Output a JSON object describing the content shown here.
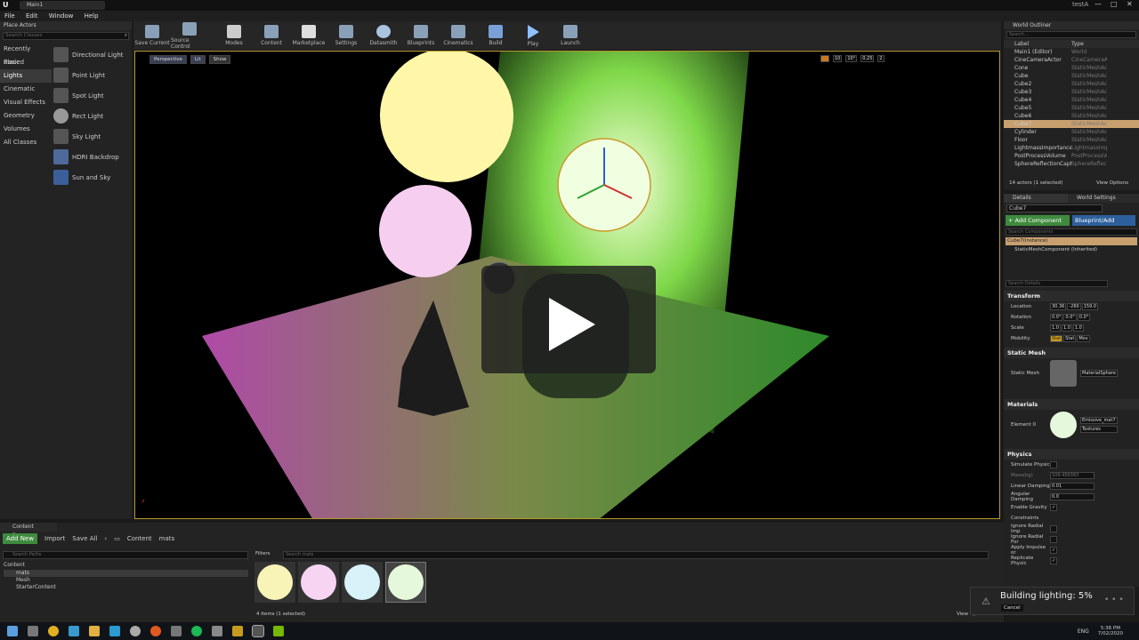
{
  "app": {
    "tab_title": "Main1",
    "project": "testA"
  },
  "menu": [
    "File",
    "Edit",
    "Window",
    "Help"
  ],
  "toolbar": [
    {
      "label": "Save Current",
      "icon": "save-icon"
    },
    {
      "label": "Source Control",
      "icon": "source-control-icon"
    },
    {
      "label": "Modes",
      "icon": "modes-icon"
    },
    {
      "label": "Content",
      "icon": "content-icon"
    },
    {
      "label": "Marketplace",
      "icon": "marketplace-icon"
    },
    {
      "label": "Settings",
      "icon": "settings-icon"
    },
    {
      "label": "Datasmith",
      "icon": "datasmith-icon"
    },
    {
      "label": "Blueprints",
      "icon": "blueprints-icon"
    },
    {
      "label": "Cinematics",
      "icon": "cinematics-icon"
    },
    {
      "label": "Build",
      "icon": "build-icon"
    },
    {
      "label": "Play",
      "icon": "play-icon"
    },
    {
      "label": "Launch",
      "icon": "launch-icon"
    }
  ],
  "place_actors": {
    "title": "Place Actors",
    "search_placeholder": "Search Classes",
    "categories": [
      "Recently Placed",
      "Basic",
      "Lights",
      "Cinematic",
      "Visual Effects",
      "Geometry",
      "Volumes",
      "All Classes"
    ],
    "actors": [
      "Directional Light",
      "Point Light",
      "Spot Light",
      "Rect Light",
      "Sky Light",
      "HDRI Backdrop",
      "Sun and Sky"
    ]
  },
  "viewport": {
    "perspective": "Perspective",
    "lit": "Lit",
    "show": "Show",
    "snap_angle": "10°",
    "grid": "10",
    "scale": "0.25",
    "cam": "2"
  },
  "outliner": {
    "title": "World Outliner",
    "search_placeholder": "Search...",
    "col_label": "Label",
    "col_type": "Type",
    "rows": [
      {
        "name": "Main1 (Editor)",
        "type": "World"
      },
      {
        "name": "CineCameraActor",
        "type": "CineCameraAc"
      },
      {
        "name": "Cone",
        "type": "StaticMeshAct"
      },
      {
        "name": "Cube",
        "type": "StaticMeshAct"
      },
      {
        "name": "Cube2",
        "type": "StaticMeshAct"
      },
      {
        "name": "Cube3",
        "type": "StaticMeshAct"
      },
      {
        "name": "Cube4",
        "type": "StaticMeshAct"
      },
      {
        "name": "Cube5",
        "type": "StaticMeshAct"
      },
      {
        "name": "Cube6",
        "type": "StaticMeshAct"
      },
      {
        "name": "Cube7",
        "type": "StaticMeshAct"
      },
      {
        "name": "Cylinder",
        "type": "StaticMeshAct"
      },
      {
        "name": "Floor",
        "type": "StaticMeshAct"
      },
      {
        "name": "LightmassImportanceVolu",
        "type": "LightmassImp"
      },
      {
        "name": "PostProcessVolume",
        "type": "PostProcessVo"
      },
      {
        "name": "SphereReflectionCapture1",
        "type": "SphereReflecti"
      }
    ],
    "footer": "14 actors (1 selected)",
    "view_options": "View Options"
  },
  "details": {
    "tab1": "Details",
    "tab2": "World Settings",
    "object": "Cube7",
    "add_component": "+ Add Component",
    "blueprint_add": "Blueprint/Add",
    "search_components": "Search Components",
    "instance": "Cube7(Instance)",
    "component": "StaticMeshComponent (Inherited)",
    "search_details": "Search Details",
    "transform": "Transform",
    "location": "Location",
    "location_vals": [
      "30.36",
      "-260",
      "159.0"
    ],
    "rotation": "Rotation",
    "rotation_vals": [
      "0.0°",
      "0.0°",
      "0.0°"
    ],
    "scale": "Scale",
    "scale_vals": [
      "1.0",
      "1.0",
      "1.0"
    ],
    "mobility": "Mobility",
    "mobility_opts": [
      "Stat",
      "Stat",
      "Mov"
    ],
    "static_mesh_sec": "Static Mesh",
    "static_mesh_label": "Static Mesh",
    "static_mesh_val": "MaterialSphere",
    "materials_sec": "Materials",
    "element0": "Element 0",
    "element0_val": "Emissive_mat7",
    "textures": "Textures",
    "physics": "Physics",
    "simulate": "Simulate Physic",
    "mass": "Mass(kg)",
    "mass_val": "109.456383",
    "linear": "Linear Damping",
    "linear_val": "0.01",
    "angular": "Angular Damping",
    "angular_val": "0.0",
    "gravity": "Enable Gravity",
    "constraints": "Constraints",
    "radial1": "Ignore Radial Imp",
    "radial2": "Ignore Radial For",
    "apply": "Apply Impulse or",
    "replicate": "Replicate Physic"
  },
  "content_browser": {
    "title": "Content Browser",
    "add_new": "Add New",
    "import": "Import",
    "save_all": "Save All",
    "crumb1": "Content",
    "crumb2": "mats",
    "search_paths": "Search Paths",
    "tree": [
      "Content",
      "mats",
      "Mesh",
      "StarterContent"
    ],
    "filters": "Filters",
    "search_mats": "Search mats",
    "footer": "4 items (1 selected)",
    "view_options": "View Options",
    "swatches": [
      "#f8f4b8",
      "#f6d4f2",
      "#d8f2fa",
      "#e6f8dc"
    ]
  },
  "toast": {
    "text": "Building lighting:  5%",
    "cancel": "Cancel"
  },
  "taskbar": {
    "lang": "ENG",
    "time": "5:36 PM",
    "date": "7/02/2020"
  }
}
